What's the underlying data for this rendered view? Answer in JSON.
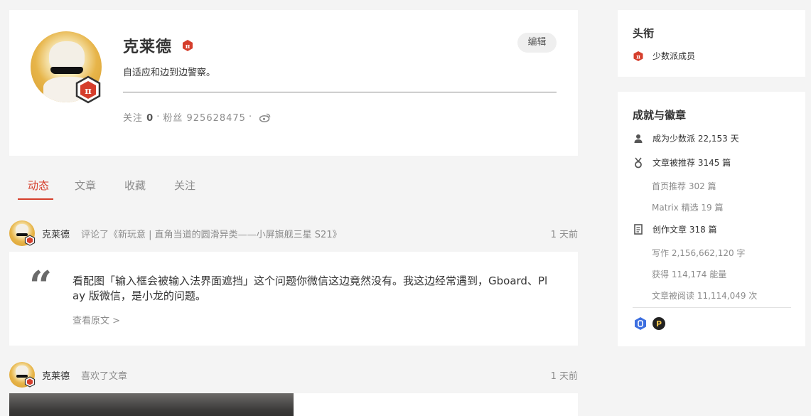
{
  "profile": {
    "name": "克莱德",
    "bio": "自适应和边到边警察。",
    "following_label": "关注",
    "following_count": "0",
    "sep1": "·",
    "followers_label": "粉丝",
    "followers_count": "925628475",
    "sep2": "·",
    "edit_label": "编辑"
  },
  "tabs": [
    "动态",
    "文章",
    "收藏",
    "关注"
  ],
  "feed": [
    {
      "user": "克莱德",
      "action": "评论了《新玩意 | 直角当道的圆滑异类——小屏旗舰三星 S21》",
      "time": "1 天前",
      "comment": "看配图「输入框会被输入法界面遮挡」这个问题你微信这边竟然没有。我这边经常遇到，Gboard、Play 版微信，是小龙的问题。",
      "view_original": "查看原文 >"
    },
    {
      "user": "克莱德",
      "action": "喜欢了文章",
      "time": "1 天前"
    }
  ],
  "sidebar": {
    "title_card": {
      "title": "头衔",
      "item": "少数派成员"
    },
    "achievements": {
      "title": "成就与徽章",
      "member_days": "成为少数派 22,153 天",
      "recommended": "文章被推荐 3145 篇",
      "homepage": "首页推荐 302 篇",
      "matrix": "Matrix 精选 19 篇",
      "created": "创作文章 318 篇",
      "words": "写作 2,156,662,120 字",
      "energy": "获得 114,174 能量",
      "reads": "文章被阅读 11,114,049 次"
    }
  },
  "colors": {
    "accent": "#d53e2c",
    "muted": "#8c8c8c",
    "background": "#f4f4f4"
  },
  "icons": [
    "pi-badge-icon",
    "weibo-icon",
    "person-icon",
    "medal-icon",
    "document-icon",
    "shield-badge-icon",
    "p-badge-icon"
  ]
}
